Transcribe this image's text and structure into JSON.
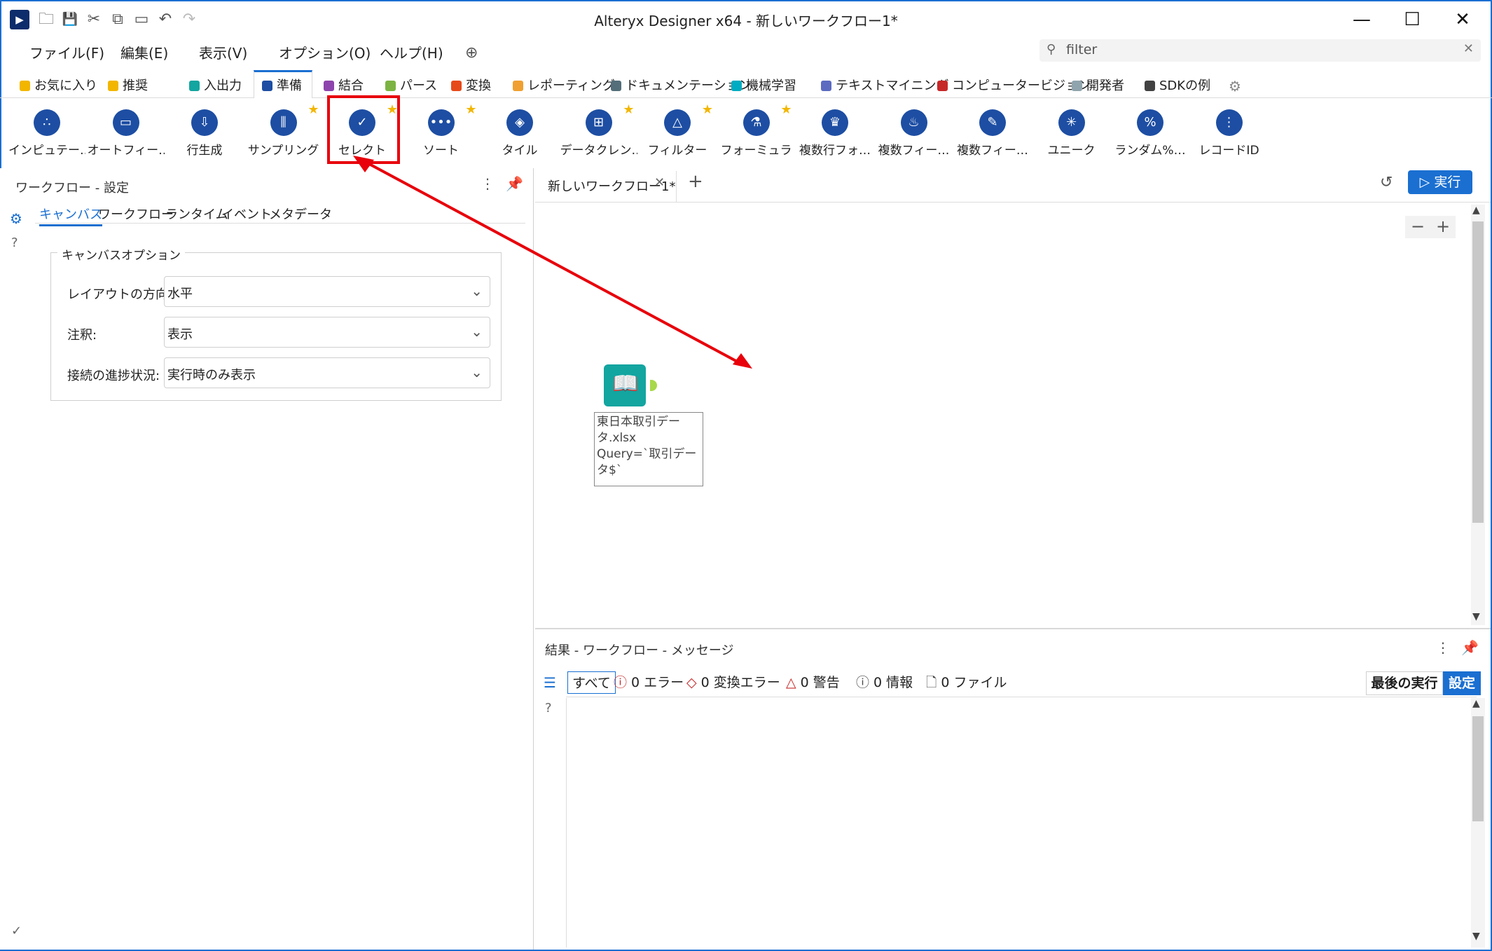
{
  "window": {
    "title": "Alteryx Designer x64 - 新しいワークフロー1*",
    "controls": [
      "—",
      "☐",
      "✕"
    ]
  },
  "menu": [
    "ファイル(F)",
    "編集(E)",
    "表示(V)",
    "オプション(O)",
    "ヘルプ(H)"
  ],
  "search": {
    "placeholder": "filter"
  },
  "categories": [
    {
      "label": "お気に入り",
      "color": "#f2b600"
    },
    {
      "label": "推奨",
      "color": "#f2b600"
    },
    {
      "label": "入出力",
      "color": "#13a5a0"
    },
    {
      "label": "準備",
      "color": "#1d4ea3"
    },
    {
      "label": "結合",
      "color": "#8e44ad"
    },
    {
      "label": "パース",
      "color": "#7cb342"
    },
    {
      "label": "変換",
      "color": "#e64a19"
    },
    {
      "label": "レポーティング",
      "color": "#f0a030"
    },
    {
      "label": "ドキュメンテーション",
      "color": "#546e7a"
    },
    {
      "label": "機械学習",
      "color": "#00acc1"
    },
    {
      "label": "テキストマイニング",
      "color": "#5c6bc0"
    },
    {
      "label": "コンピュータービジョン",
      "color": "#c62828"
    },
    {
      "label": "開発者",
      "color": "#90a4ae"
    },
    {
      "label": "SDKの例",
      "color": "#424242"
    }
  ],
  "tools": [
    {
      "label": "インピュテー…",
      "star": false
    },
    {
      "label": "オートフィー…",
      "star": false
    },
    {
      "label": "行生成",
      "star": false
    },
    {
      "label": "サンプリング",
      "star": true
    },
    {
      "label": "セレクト",
      "star": true
    },
    {
      "label": "ソート",
      "star": true
    },
    {
      "label": "タイル",
      "star": false
    },
    {
      "label": "データクレン…",
      "star": true
    },
    {
      "label": "フィルター",
      "star": true
    },
    {
      "label": "フォーミュラ",
      "star": true
    },
    {
      "label": "複数行フォ…",
      "star": false
    },
    {
      "label": "複数フィー…",
      "star": false
    },
    {
      "label": "複数フィー…",
      "star": false
    },
    {
      "label": "ユニーク",
      "star": false
    },
    {
      "label": "ランダム%…",
      "star": false
    },
    {
      "label": "レコードID",
      "star": false
    }
  ],
  "left_panel": {
    "title": "ワークフロー - 設定",
    "tabs": [
      "キャンバス",
      "ワークフロー",
      "ランタイム",
      "イベント",
      "メタデータ"
    ],
    "group_title": "キャンバスオプション",
    "options": [
      {
        "label": "レイアウトの方向:",
        "value": "水平"
      },
      {
        "label": "注釈:",
        "value": "表示"
      },
      {
        "label": "接続の進捗状況:",
        "value": "実行時のみ表示"
      }
    ]
  },
  "canvas": {
    "tab_label": "新しいワークフロー1*",
    "run_label": "実行",
    "node_label": "東日本取引データ.xlsx\nQuery=`取引データ$`"
  },
  "results": {
    "title": "結果 - ワークフロー - メッセージ",
    "filters": [
      "すべて",
      "0 エラー",
      "0 変換エラー",
      "0 警告",
      "0 情報",
      "0 ファイル"
    ],
    "last_run": "最後の実行",
    "settings": "設定"
  },
  "annotation": {
    "box_color": "#e8000b"
  }
}
